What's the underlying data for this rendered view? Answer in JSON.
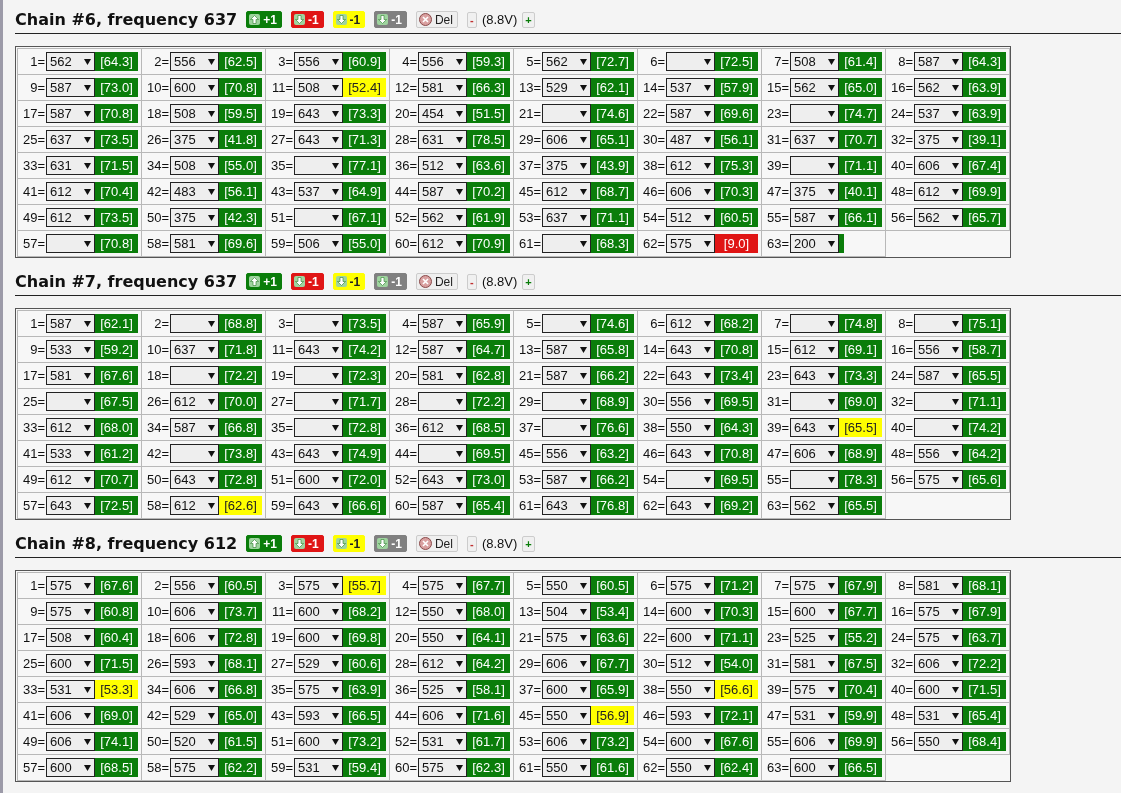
{
  "chains": [
    {
      "title": "Chain #6, frequency 637",
      "actions": [
        {
          "kind": "up",
          "color": "#0a7d0a",
          "label": "+1"
        },
        {
          "kind": "down",
          "color": "#e01515",
          "label": "-1"
        },
        {
          "kind": "down",
          "color": "#ffff00",
          "label": "-1"
        },
        {
          "kind": "down",
          "color": "#808080",
          "label": "-1"
        },
        {
          "kind": "delete",
          "color": "#efefef",
          "label": "Del"
        }
      ],
      "voltage": {
        "minus": "-",
        "value": "(8.8V)",
        "plus": "+"
      },
      "chips": [
        {
          "label": "1=",
          "value": "562",
          "reading": "[64.3]",
          "color": "#0a7d0a"
        },
        {
          "label": "2=",
          "value": "556",
          "reading": "[62.5]",
          "color": "#0a7d0a"
        },
        {
          "label": "3=",
          "value": "556",
          "reading": "[60.9]",
          "color": "#0a7d0a"
        },
        {
          "label": "4=",
          "value": "556",
          "reading": "[59.3]",
          "color": "#0a7d0a"
        },
        {
          "label": "5=",
          "value": "562",
          "reading": "[72.7]",
          "color": "#0a7d0a"
        },
        {
          "label": "6=",
          "reading": "[72.5]",
          "color": "#0a7d0a"
        },
        {
          "label": "7=",
          "value": "508",
          "reading": "[61.4]",
          "color": "#0a7d0a"
        },
        {
          "label": "8=",
          "value": "587",
          "reading": "[64.3]",
          "color": "#0a7d0a"
        },
        {
          "label": "9=",
          "value": "587",
          "reading": "[73.0]",
          "color": "#0a7d0a"
        },
        {
          "label": "10=",
          "value": "600",
          "reading": "[70.8]",
          "color": "#0a7d0a"
        },
        {
          "label": "11=",
          "value": "508",
          "reading": "[52.4]",
          "color": "#ffff00"
        },
        {
          "label": "12=",
          "value": "581",
          "reading": "[66.3]",
          "color": "#0a7d0a"
        },
        {
          "label": "13=",
          "value": "529",
          "reading": "[62.1]",
          "color": "#0a7d0a"
        },
        {
          "label": "14=",
          "value": "537",
          "reading": "[57.9]",
          "color": "#0a7d0a"
        },
        {
          "label": "15=",
          "value": "562",
          "reading": "[65.0]",
          "color": "#0a7d0a"
        },
        {
          "label": "16=",
          "value": "562",
          "reading": "[63.9]",
          "color": "#0a7d0a"
        },
        {
          "label": "17=",
          "value": "587",
          "reading": "[70.8]",
          "color": "#0a7d0a"
        },
        {
          "label": "18=",
          "value": "508",
          "reading": "[59.5]",
          "color": "#0a7d0a"
        },
        {
          "label": "19=",
          "value": "643",
          "reading": "[73.3]",
          "color": "#0a7d0a"
        },
        {
          "label": "20=",
          "value": "454",
          "reading": "[51.5]",
          "color": "#0a7d0a"
        },
        {
          "label": "21=",
          "reading": "[74.6]",
          "color": "#0a7d0a"
        },
        {
          "label": "22=",
          "value": "587",
          "reading": "[69.6]",
          "color": "#0a7d0a"
        },
        {
          "label": "23=",
          "reading": "[74.7]",
          "color": "#0a7d0a"
        },
        {
          "label": "24=",
          "value": "537",
          "reading": "[63.9]",
          "color": "#0a7d0a"
        },
        {
          "label": "25=",
          "value": "637",
          "reading": "[73.5]",
          "color": "#0a7d0a"
        },
        {
          "label": "26=",
          "value": "375",
          "reading": "[41.8]",
          "color": "#0a7d0a"
        },
        {
          "label": "27=",
          "value": "643",
          "reading": "[71.3]",
          "color": "#0a7d0a"
        },
        {
          "label": "28=",
          "value": "631",
          "reading": "[78.5]",
          "color": "#0a7d0a"
        },
        {
          "label": "29=",
          "value": "606",
          "reading": "[65.1]",
          "color": "#0a7d0a"
        },
        {
          "label": "30=",
          "value": "487",
          "reading": "[56.1]",
          "color": "#0a7d0a"
        },
        {
          "label": "31=",
          "value": "637",
          "reading": "[70.7]",
          "color": "#0a7d0a"
        },
        {
          "label": "32=",
          "value": "375",
          "reading": "[39.1]",
          "color": "#0a7d0a"
        },
        {
          "label": "33=",
          "value": "631",
          "reading": "[71.5]",
          "color": "#0a7d0a"
        },
        {
          "label": "34=",
          "value": "508",
          "reading": "[55.0]",
          "color": "#0a7d0a"
        },
        {
          "label": "35=",
          "reading": "[77.1]",
          "color": "#0a7d0a"
        },
        {
          "label": "36=",
          "value": "512",
          "reading": "[63.6]",
          "color": "#0a7d0a"
        },
        {
          "label": "37=",
          "value": "375",
          "reading": "[43.9]",
          "color": "#0a7d0a"
        },
        {
          "label": "38=",
          "value": "612",
          "reading": "[75.3]",
          "color": "#0a7d0a"
        },
        {
          "label": "39=",
          "reading": "[71.1]",
          "color": "#0a7d0a"
        },
        {
          "label": "40=",
          "value": "606",
          "reading": "[67.4]",
          "color": "#0a7d0a"
        },
        {
          "label": "41=",
          "value": "612",
          "reading": "[70.4]",
          "color": "#0a7d0a"
        },
        {
          "label": "42=",
          "value": "483",
          "reading": "[56.1]",
          "color": "#0a7d0a"
        },
        {
          "label": "43=",
          "value": "537",
          "reading": "[64.9]",
          "color": "#0a7d0a"
        },
        {
          "label": "44=",
          "value": "587",
          "reading": "[70.2]",
          "color": "#0a7d0a"
        },
        {
          "label": "45=",
          "value": "612",
          "reading": "[68.7]",
          "color": "#0a7d0a"
        },
        {
          "label": "46=",
          "value": "606",
          "reading": "[70.3]",
          "color": "#0a7d0a"
        },
        {
          "label": "47=",
          "value": "375",
          "reading": "[40.1]",
          "color": "#0a7d0a"
        },
        {
          "label": "48=",
          "value": "612",
          "reading": "[69.9]",
          "color": "#0a7d0a"
        },
        {
          "label": "49=",
          "value": "612",
          "reading": "[73.5]",
          "color": "#0a7d0a"
        },
        {
          "label": "50=",
          "value": "375",
          "reading": "[42.3]",
          "color": "#0a7d0a"
        },
        {
          "label": "51=",
          "reading": "[67.1]",
          "color": "#0a7d0a"
        },
        {
          "label": "52=",
          "value": "562",
          "reading": "[61.9]",
          "color": "#0a7d0a"
        },
        {
          "label": "53=",
          "value": "637",
          "reading": "[71.1]",
          "color": "#0a7d0a"
        },
        {
          "label": "54=",
          "value": "512",
          "reading": "[60.5]",
          "color": "#0a7d0a"
        },
        {
          "label": "55=",
          "value": "587",
          "reading": "[66.1]",
          "color": "#0a7d0a"
        },
        {
          "label": "56=",
          "value": "562",
          "reading": "[65.7]",
          "color": "#0a7d0a"
        },
        {
          "label": "57=",
          "reading": "[70.8]",
          "color": "#0a7d0a"
        },
        {
          "label": "58=",
          "value": "581",
          "reading": "[69.6]",
          "color": "#0a7d0a"
        },
        {
          "label": "59=",
          "value": "506",
          "reading": "[55.0]",
          "color": "#0a7d0a"
        },
        {
          "label": "60=",
          "value": "612",
          "reading": "[70.9]",
          "color": "#0a7d0a"
        },
        {
          "label": "61=",
          "reading": "[68.3]",
          "color": "#0a7d0a"
        },
        {
          "label": "62=",
          "value": "575",
          "reading": "[9.0]",
          "color": "#e01515"
        },
        {
          "label": "63=",
          "value": "200",
          "color": "#0a7d0a"
        }
      ]
    },
    {
      "title": "Chain #7, frequency 637",
      "actions": [
        {
          "kind": "up",
          "color": "#0a7d0a",
          "label": "+1"
        },
        {
          "kind": "down",
          "color": "#e01515",
          "label": "-1"
        },
        {
          "kind": "down",
          "color": "#ffff00",
          "label": "-1"
        },
        {
          "kind": "down",
          "color": "#808080",
          "label": "-1"
        },
        {
          "kind": "delete",
          "color": "#efefef",
          "label": "Del"
        }
      ],
      "voltage": {
        "minus": "-",
        "value": "(8.8V)",
        "plus": "+"
      },
      "chips": [
        {
          "label": "1=",
          "value": "587",
          "reading": "[62.1]",
          "color": "#0a7d0a"
        },
        {
          "label": "2=",
          "reading": "[68.8]",
          "color": "#0a7d0a"
        },
        {
          "label": "3=",
          "reading": "[73.5]",
          "color": "#0a7d0a"
        },
        {
          "label": "4=",
          "value": "587",
          "reading": "[65.9]",
          "color": "#0a7d0a"
        },
        {
          "label": "5=",
          "reading": "[74.6]",
          "color": "#0a7d0a"
        },
        {
          "label": "6=",
          "value": "612",
          "reading": "[68.2]",
          "color": "#0a7d0a"
        },
        {
          "label": "7=",
          "reading": "[74.8]",
          "color": "#0a7d0a"
        },
        {
          "label": "8=",
          "reading": "[75.1]",
          "color": "#0a7d0a"
        },
        {
          "label": "9=",
          "value": "533",
          "reading": "[59.2]",
          "color": "#0a7d0a"
        },
        {
          "label": "10=",
          "value": "637",
          "reading": "[71.8]",
          "color": "#0a7d0a"
        },
        {
          "label": "11=",
          "value": "643",
          "reading": "[74.2]",
          "color": "#0a7d0a"
        },
        {
          "label": "12=",
          "value": "587",
          "reading": "[64.7]",
          "color": "#0a7d0a"
        },
        {
          "label": "13=",
          "value": "587",
          "reading": "[65.8]",
          "color": "#0a7d0a"
        },
        {
          "label": "14=",
          "value": "643",
          "reading": "[70.8]",
          "color": "#0a7d0a"
        },
        {
          "label": "15=",
          "value": "612",
          "reading": "[69.1]",
          "color": "#0a7d0a"
        },
        {
          "label": "16=",
          "value": "556",
          "reading": "[58.7]",
          "color": "#0a7d0a"
        },
        {
          "label": "17=",
          "value": "581",
          "reading": "[67.6]",
          "color": "#0a7d0a"
        },
        {
          "label": "18=",
          "reading": "[72.2]",
          "color": "#0a7d0a"
        },
        {
          "label": "19=",
          "reading": "[72.3]",
          "color": "#0a7d0a"
        },
        {
          "label": "20=",
          "value": "581",
          "reading": "[62.8]",
          "color": "#0a7d0a"
        },
        {
          "label": "21=",
          "value": "587",
          "reading": "[66.2]",
          "color": "#0a7d0a"
        },
        {
          "label": "22=",
          "value": "643",
          "reading": "[73.4]",
          "color": "#0a7d0a"
        },
        {
          "label": "23=",
          "value": "643",
          "reading": "[73.3]",
          "color": "#0a7d0a"
        },
        {
          "label": "24=",
          "value": "587",
          "reading": "[65.5]",
          "color": "#0a7d0a"
        },
        {
          "label": "25=",
          "reading": "[67.5]",
          "color": "#0a7d0a"
        },
        {
          "label": "26=",
          "value": "612",
          "reading": "[70.0]",
          "color": "#0a7d0a"
        },
        {
          "label": "27=",
          "reading": "[71.7]",
          "color": "#0a7d0a"
        },
        {
          "label": "28=",
          "reading": "[72.2]",
          "color": "#0a7d0a"
        },
        {
          "label": "29=",
          "reading": "[68.9]",
          "color": "#0a7d0a"
        },
        {
          "label": "30=",
          "value": "556",
          "reading": "[69.5]",
          "color": "#0a7d0a"
        },
        {
          "label": "31=",
          "reading": "[69.0]",
          "color": "#0a7d0a"
        },
        {
          "label": "32=",
          "reading": "[71.1]",
          "color": "#0a7d0a"
        },
        {
          "label": "33=",
          "value": "612",
          "reading": "[68.0]",
          "color": "#0a7d0a"
        },
        {
          "label": "34=",
          "value": "587",
          "reading": "[66.8]",
          "color": "#0a7d0a"
        },
        {
          "label": "35=",
          "reading": "[72.8]",
          "color": "#0a7d0a"
        },
        {
          "label": "36=",
          "value": "612",
          "reading": "[68.5]",
          "color": "#0a7d0a"
        },
        {
          "label": "37=",
          "reading": "[76.6]",
          "color": "#0a7d0a"
        },
        {
          "label": "38=",
          "value": "550",
          "reading": "[64.3]",
          "color": "#0a7d0a"
        },
        {
          "label": "39=",
          "value": "643",
          "reading": "[65.5]",
          "color": "#ffff00"
        },
        {
          "label": "40=",
          "reading": "[74.2]",
          "color": "#0a7d0a"
        },
        {
          "label": "41=",
          "value": "533",
          "reading": "[61.2]",
          "color": "#0a7d0a"
        },
        {
          "label": "42=",
          "reading": "[73.8]",
          "color": "#0a7d0a"
        },
        {
          "label": "43=",
          "value": "643",
          "reading": "[74.9]",
          "color": "#0a7d0a"
        },
        {
          "label": "44=",
          "reading": "[69.5]",
          "color": "#0a7d0a"
        },
        {
          "label": "45=",
          "value": "556",
          "reading": "[63.2]",
          "color": "#0a7d0a"
        },
        {
          "label": "46=",
          "value": "643",
          "reading": "[70.8]",
          "color": "#0a7d0a"
        },
        {
          "label": "47=",
          "value": "606",
          "reading": "[68.9]",
          "color": "#0a7d0a"
        },
        {
          "label": "48=",
          "value": "556",
          "reading": "[64.2]",
          "color": "#0a7d0a"
        },
        {
          "label": "49=",
          "value": "612",
          "reading": "[70.7]",
          "color": "#0a7d0a"
        },
        {
          "label": "50=",
          "value": "643",
          "reading": "[72.8]",
          "color": "#0a7d0a"
        },
        {
          "label": "51=",
          "value": "600",
          "reading": "[72.0]",
          "color": "#0a7d0a"
        },
        {
          "label": "52=",
          "value": "643",
          "reading": "[73.0]",
          "color": "#0a7d0a"
        },
        {
          "label": "53=",
          "value": "587",
          "reading": "[66.2]",
          "color": "#0a7d0a"
        },
        {
          "label": "54=",
          "reading": "[69.5]",
          "color": "#0a7d0a"
        },
        {
          "label": "55=",
          "reading": "[78.3]",
          "color": "#0a7d0a"
        },
        {
          "label": "56=",
          "value": "575",
          "reading": "[65.6]",
          "color": "#0a7d0a"
        },
        {
          "label": "57=",
          "value": "643",
          "reading": "[72.5]",
          "color": "#0a7d0a"
        },
        {
          "label": "58=",
          "value": "612",
          "reading": "[62.6]",
          "color": "#ffff00"
        },
        {
          "label": "59=",
          "value": "643",
          "reading": "[66.6]",
          "color": "#0a7d0a"
        },
        {
          "label": "60=",
          "value": "587",
          "reading": "[65.4]",
          "color": "#0a7d0a"
        },
        {
          "label": "61=",
          "value": "643",
          "reading": "[76.8]",
          "color": "#0a7d0a"
        },
        {
          "label": "62=",
          "value": "643",
          "reading": "[69.2]",
          "color": "#0a7d0a"
        },
        {
          "label": "63=",
          "value": "562",
          "reading": "[65.5]",
          "color": "#0a7d0a"
        }
      ]
    },
    {
      "title": "Chain #8, frequency 612",
      "actions": [
        {
          "kind": "up",
          "color": "#0a7d0a",
          "label": "+1"
        },
        {
          "kind": "down",
          "color": "#e01515",
          "label": "-1"
        },
        {
          "kind": "down",
          "color": "#ffff00",
          "label": "-1"
        },
        {
          "kind": "down",
          "color": "#808080",
          "label": "-1"
        },
        {
          "kind": "delete",
          "color": "#efefef",
          "label": "Del"
        }
      ],
      "voltage": {
        "minus": "-",
        "value": "(8.8V)",
        "plus": "+"
      },
      "chips": [
        {
          "label": "1=",
          "value": "575",
          "reading": "[67.6]",
          "color": "#0a7d0a"
        },
        {
          "label": "2=",
          "value": "556",
          "reading": "[60.5]",
          "color": "#0a7d0a"
        },
        {
          "label": "3=",
          "value": "575",
          "reading": "[55.7]",
          "color": "#ffff00"
        },
        {
          "label": "4=",
          "value": "575",
          "reading": "[67.7]",
          "color": "#0a7d0a"
        },
        {
          "label": "5=",
          "value": "550",
          "reading": "[60.5]",
          "color": "#0a7d0a"
        },
        {
          "label": "6=",
          "value": "575",
          "reading": "[71.2]",
          "color": "#0a7d0a"
        },
        {
          "label": "7=",
          "value": "575",
          "reading": "[67.9]",
          "color": "#0a7d0a"
        },
        {
          "label": "8=",
          "value": "581",
          "reading": "[68.1]",
          "color": "#0a7d0a"
        },
        {
          "label": "9=",
          "value": "575",
          "reading": "[60.8]",
          "color": "#0a7d0a"
        },
        {
          "label": "10=",
          "value": "606",
          "reading": "[73.7]",
          "color": "#0a7d0a"
        },
        {
          "label": "11=",
          "value": "600",
          "reading": "[68.2]",
          "color": "#0a7d0a"
        },
        {
          "label": "12=",
          "value": "550",
          "reading": "[68.0]",
          "color": "#0a7d0a"
        },
        {
          "label": "13=",
          "value": "504",
          "reading": "[53.4]",
          "color": "#0a7d0a"
        },
        {
          "label": "14=",
          "value": "600",
          "reading": "[70.3]",
          "color": "#0a7d0a"
        },
        {
          "label": "15=",
          "value": "600",
          "reading": "[67.7]",
          "color": "#0a7d0a"
        },
        {
          "label": "16=",
          "value": "575",
          "reading": "[67.9]",
          "color": "#0a7d0a"
        },
        {
          "label": "17=",
          "value": "508",
          "reading": "[60.4]",
          "color": "#0a7d0a"
        },
        {
          "label": "18=",
          "value": "606",
          "reading": "[72.8]",
          "color": "#0a7d0a"
        },
        {
          "label": "19=",
          "value": "600",
          "reading": "[69.8]",
          "color": "#0a7d0a"
        },
        {
          "label": "20=",
          "value": "550",
          "reading": "[64.1]",
          "color": "#0a7d0a"
        },
        {
          "label": "21=",
          "value": "575",
          "reading": "[63.6]",
          "color": "#0a7d0a"
        },
        {
          "label": "22=",
          "value": "600",
          "reading": "[71.1]",
          "color": "#0a7d0a"
        },
        {
          "label": "23=",
          "value": "525",
          "reading": "[55.2]",
          "color": "#0a7d0a"
        },
        {
          "label": "24=",
          "value": "575",
          "reading": "[63.7]",
          "color": "#0a7d0a"
        },
        {
          "label": "25=",
          "value": "600",
          "reading": "[71.5]",
          "color": "#0a7d0a"
        },
        {
          "label": "26=",
          "value": "593",
          "reading": "[68.1]",
          "color": "#0a7d0a"
        },
        {
          "label": "27=",
          "value": "529",
          "reading": "[60.6]",
          "color": "#0a7d0a"
        },
        {
          "label": "28=",
          "value": "612",
          "reading": "[64.2]",
          "color": "#0a7d0a"
        },
        {
          "label": "29=",
          "value": "606",
          "reading": "[67.7]",
          "color": "#0a7d0a"
        },
        {
          "label": "30=",
          "value": "512",
          "reading": "[54.0]",
          "color": "#0a7d0a"
        },
        {
          "label": "31=",
          "value": "581",
          "reading": "[67.5]",
          "color": "#0a7d0a"
        },
        {
          "label": "32=",
          "value": "606",
          "reading": "[72.2]",
          "color": "#0a7d0a"
        },
        {
          "label": "33=",
          "value": "531",
          "reading": "[53.3]",
          "color": "#ffff00"
        },
        {
          "label": "34=",
          "value": "606",
          "reading": "[66.8]",
          "color": "#0a7d0a"
        },
        {
          "label": "35=",
          "value": "575",
          "reading": "[63.9]",
          "color": "#0a7d0a"
        },
        {
          "label": "36=",
          "value": "525",
          "reading": "[58.1]",
          "color": "#0a7d0a"
        },
        {
          "label": "37=",
          "value": "600",
          "reading": "[65.9]",
          "color": "#0a7d0a"
        },
        {
          "label": "38=",
          "value": "550",
          "reading": "[56.6]",
          "color": "#ffff00"
        },
        {
          "label": "39=",
          "value": "575",
          "reading": "[70.4]",
          "color": "#0a7d0a"
        },
        {
          "label": "40=",
          "value": "600",
          "reading": "[71.5]",
          "color": "#0a7d0a"
        },
        {
          "label": "41=",
          "value": "606",
          "reading": "[69.0]",
          "color": "#0a7d0a"
        },
        {
          "label": "42=",
          "value": "529",
          "reading": "[65.0]",
          "color": "#0a7d0a"
        },
        {
          "label": "43=",
          "value": "593",
          "reading": "[66.5]",
          "color": "#0a7d0a"
        },
        {
          "label": "44=",
          "value": "606",
          "reading": "[71.6]",
          "color": "#0a7d0a"
        },
        {
          "label": "45=",
          "value": "550",
          "reading": "[56.9]",
          "color": "#ffff00"
        },
        {
          "label": "46=",
          "value": "593",
          "reading": "[72.1]",
          "color": "#0a7d0a"
        },
        {
          "label": "47=",
          "value": "531",
          "reading": "[59.9]",
          "color": "#0a7d0a"
        },
        {
          "label": "48=",
          "value": "531",
          "reading": "[65.4]",
          "color": "#0a7d0a"
        },
        {
          "label": "49=",
          "value": "606",
          "reading": "[74.1]",
          "color": "#0a7d0a"
        },
        {
          "label": "50=",
          "value": "520",
          "reading": "[61.5]",
          "color": "#0a7d0a"
        },
        {
          "label": "51=",
          "value": "600",
          "reading": "[73.2]",
          "color": "#0a7d0a"
        },
        {
          "label": "52=",
          "value": "531",
          "reading": "[61.7]",
          "color": "#0a7d0a"
        },
        {
          "label": "53=",
          "value": "606",
          "reading": "[73.2]",
          "color": "#0a7d0a"
        },
        {
          "label": "54=",
          "value": "600",
          "reading": "[67.6]",
          "color": "#0a7d0a"
        },
        {
          "label": "55=",
          "value": "606",
          "reading": "[69.9]",
          "color": "#0a7d0a"
        },
        {
          "label": "56=",
          "value": "550",
          "reading": "[68.4]",
          "color": "#0a7d0a"
        },
        {
          "label": "57=",
          "value": "600",
          "reading": "[68.5]",
          "color": "#0a7d0a"
        },
        {
          "label": "58=",
          "value": "575",
          "reading": "[62.2]",
          "color": "#0a7d0a"
        },
        {
          "label": "59=",
          "value": "531",
          "reading": "[59.4]",
          "color": "#0a7d0a"
        },
        {
          "label": "60=",
          "value": "575",
          "reading": "[62.3]",
          "color": "#0a7d0a"
        },
        {
          "label": "61=",
          "value": "550",
          "reading": "[61.6]",
          "color": "#0a7d0a"
        },
        {
          "label": "62=",
          "value": "550",
          "reading": "[62.4]",
          "color": "#0a7d0a"
        },
        {
          "label": "63=",
          "value": "600",
          "reading": "[66.5]",
          "color": "#0a7d0a"
        }
      ]
    }
  ]
}
